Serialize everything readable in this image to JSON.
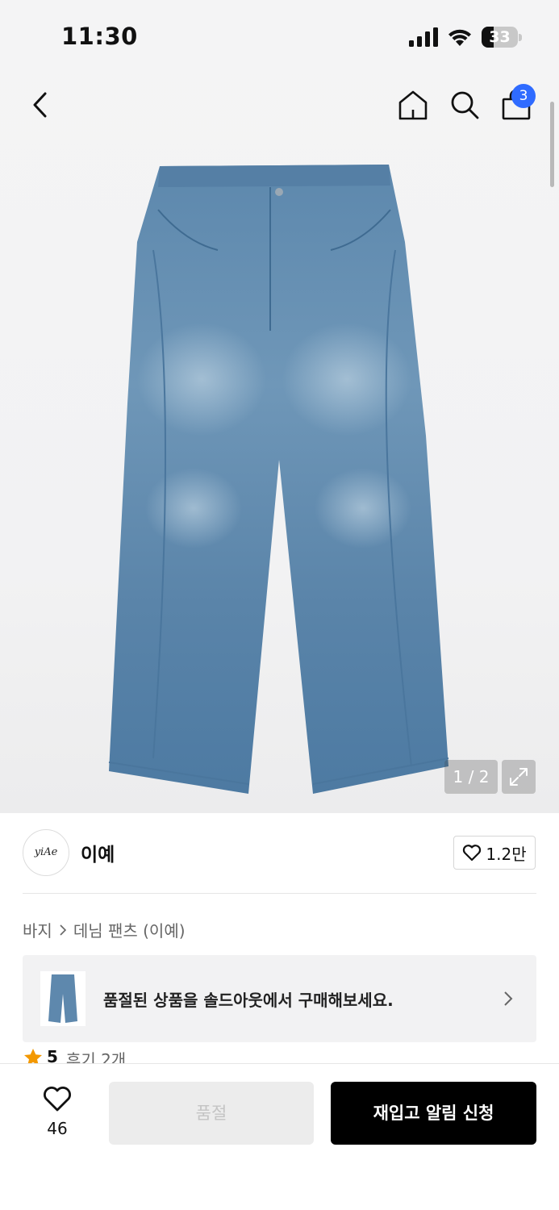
{
  "status_bar": {
    "time": "11:30",
    "battery": {
      "level": "33",
      "fraction": 0.33
    },
    "icons": [
      "cellular-signal-icon",
      "wifi-icon",
      "battery-icon"
    ]
  },
  "nav": {
    "icons": [
      "chevron-left-icon",
      "home-icon",
      "search-icon",
      "shopping-bag-icon"
    ],
    "cart_count": "3",
    "accent_color": "#2f6bff"
  },
  "gallery": {
    "counter": "1 / 2",
    "image_subject": "jeans",
    "expand_icon": "expand-icon"
  },
  "brand": {
    "logo_text": "yiAe",
    "name": "이예",
    "likes": "1.2만"
  },
  "breadcrumb": {
    "items": [
      "바지",
      "데님 팬츠 (이예)"
    ]
  },
  "soldout_banner": {
    "text": "품절된 상품을 솔드아웃에서 구매해보세요."
  },
  "rating": {
    "score": "5",
    "reviews": "후기 2개",
    "star_color": "#f39800"
  },
  "bottom_bar": {
    "wish_count": "46",
    "soldout_label": "품절",
    "restock_label": "재입고 알림 신청"
  }
}
